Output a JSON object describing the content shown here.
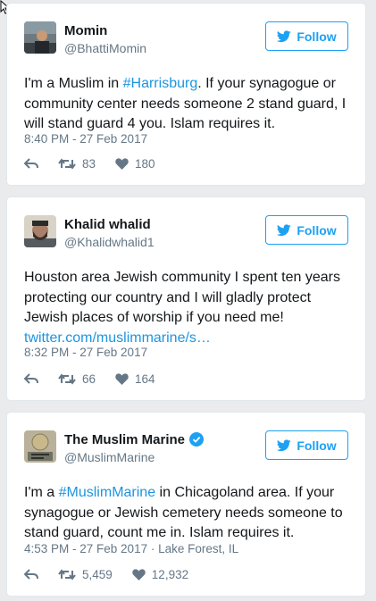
{
  "tweets": [
    {
      "name": "Momin",
      "handle": "@BhattiMomin",
      "follow_label": "Follow",
      "text_before": "I'm a Muslim in ",
      "hashtag": "#Harrisburg",
      "text_after": ". If your synagogue or community center needs someone 2 stand guard, I will stand guard 4 you. Islam requires it.",
      "timestamp": "8:40 PM - 27 Feb 2017",
      "retweets": "83",
      "likes": "180"
    },
    {
      "name": "Khalid whalid",
      "handle": "@Khalidwhalid1",
      "follow_label": "Follow",
      "text": "Houston area Jewish community I spent ten years protecting our country and I will gladly protect Jewish places of worship if you need me!",
      "link": "twitter.com/muslimmarine/s…",
      "timestamp": "8:32 PM - 27 Feb 2017",
      "retweets": "66",
      "likes": "164"
    },
    {
      "name": "The Muslim Marine",
      "handle": "@MuslimMarine",
      "verified": true,
      "follow_label": "Follow",
      "text_before": "I'm a ",
      "hashtag": "#MuslimMarine",
      "text_after": " in Chicagoland area. If your synagogue or Jewish cemetery needs someone to stand guard, count me in. Islam requires it.",
      "timestamp": "4:53 PM - 27 Feb 2017",
      "location": "Lake Forest, IL",
      "retweets": "5,459",
      "likes": "12,932"
    }
  ],
  "icons": {
    "follow": "twitter-bird-icon",
    "reply": "reply-icon",
    "retweet": "retweet-icon",
    "like": "heart-icon",
    "verified": "verified-badge-icon"
  },
  "colors": {
    "accent": "#1da1f2",
    "link": "#1b95e0",
    "muted": "#657786",
    "background": "#e9ebed"
  }
}
